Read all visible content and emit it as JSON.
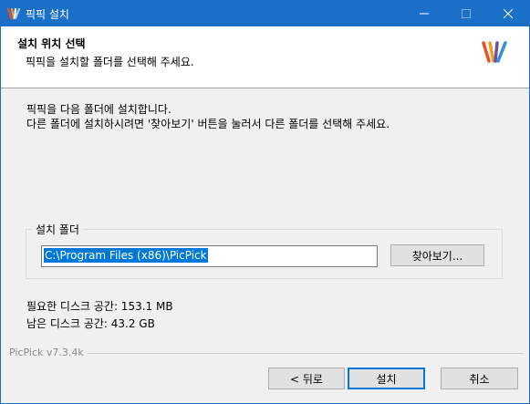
{
  "window": {
    "title": "픽픽 설치",
    "icons": {
      "app": "picpick-logo-icon",
      "minimize": "minimize-icon",
      "maximize": "maximize-icon",
      "close": "close-icon"
    }
  },
  "header": {
    "title": "설치 위치 선택",
    "subtitle": "픽픽을 설치할 폴더를 선택해 주세요."
  },
  "description": {
    "line1": "픽픽을 다음 폴더에 설치합니다.",
    "line2": "다른 폴더에 설치하시려면 '찾아보기' 버튼을 눌러서 다른 폴더를 선택해 주세요."
  },
  "folder_group": {
    "label": "설치 폴더",
    "path": "C:\\Program Files (x86)\\PicPick",
    "browse_label": "찾아보기..."
  },
  "space": {
    "required": "필요한 디스크 공간: 153.1 MB",
    "available": "남은 디스크 공간: 43.2 GB"
  },
  "footer": {
    "version": "PicPick v7.3.4k",
    "back_label": "< 뒤로",
    "install_label": "설치",
    "cancel_label": "취소"
  },
  "colors": {
    "titlebar": "#1a6fc7",
    "selection": "#0078d7",
    "logo": [
      "#e8502a",
      "#f59a1b",
      "#6b4fa0",
      "#2f8fd8"
    ]
  }
}
